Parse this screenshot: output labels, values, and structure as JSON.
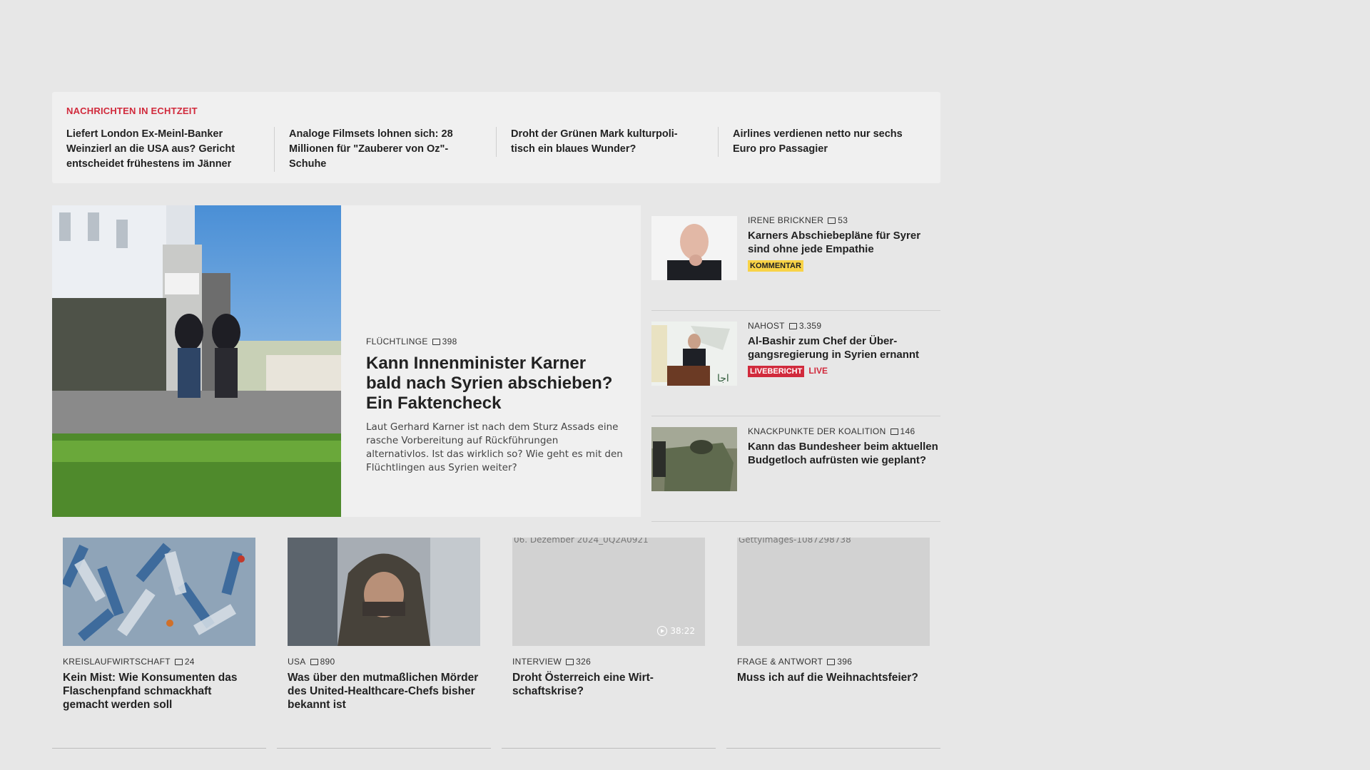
{
  "ticker": {
    "label": "NACHRICHTEN IN ECHTZEIT",
    "items": [
      "Liefert London Ex-Meinl-Banker Weinzierl an die USA aus? Gericht entscheidet frühestens im Jänner",
      "Analoge Filmsets lohnen sich: 28 Mil­lionen für \"Zauberer von Oz\"- Schuhe",
      "Droht der Grünen Mark kulturpoli­tisch ein blaues Wunder?",
      "Airlines verdienen netto nur sechs Euro pro Passagier"
    ]
  },
  "lead": {
    "category": "FLÜCHTLINGE",
    "comments": "398",
    "title": "Kann Innenminister Karner bald nach Syrien abschieben? Ein Faktencheck",
    "description": "Laut Gerhard Karner ist nach dem Sturz Assads eine rasche Vorbereitung auf Rückführungen alternativlos. Ist das wirklich so? Wie geht es mit den Flüchtlingen aus Syrien weiter?"
  },
  "side": [
    {
      "category": "IRENE BRICKNER",
      "comments": "53",
      "title": "Karners Abschiebepläne für Syrer sind ohne jede Empathie",
      "badge": "KOMMENTAR"
    },
    {
      "category": "NAHOST",
      "comments": "3.359",
      "title": "Al-Bashir zum Chef der Über­gangsregierung in Syrien ernannt",
      "badge": "LIVEBERICHT",
      "live": "LIVE"
    },
    {
      "category": "KNACKPUNKTE DER KOALITION",
      "comments": "146",
      "title": "Kann das Bundesheer beim aktuellen Budgetloch aufrüsten wie geplant?"
    }
  ],
  "cards": [
    {
      "category": "KREISLAUFWIRTSCHAFT",
      "comments": "24",
      "title": "Kein Mist: Wie Konsumenten das Flaschenpfand schmackhaft gemacht werden soll"
    },
    {
      "category": "USA",
      "comments": "890",
      "title": "Was über den mutmaßlichen Mörder des United-Healthcare-Chefs bisher bekannt ist"
    },
    {
      "category": "INTERVIEW",
      "comments": "326",
      "title": "Droht Österreich eine Wirt­schaftskrise?",
      "image_alt": "06. Dezember 2024_0Q2A0921",
      "duration": "38:22"
    },
    {
      "category": "FRAGE & ANTWORT",
      "comments": "396",
      "title": "Muss ich auf die Weihnachtsfeier?",
      "image_alt": "GettyImages-1087298738"
    }
  ]
}
